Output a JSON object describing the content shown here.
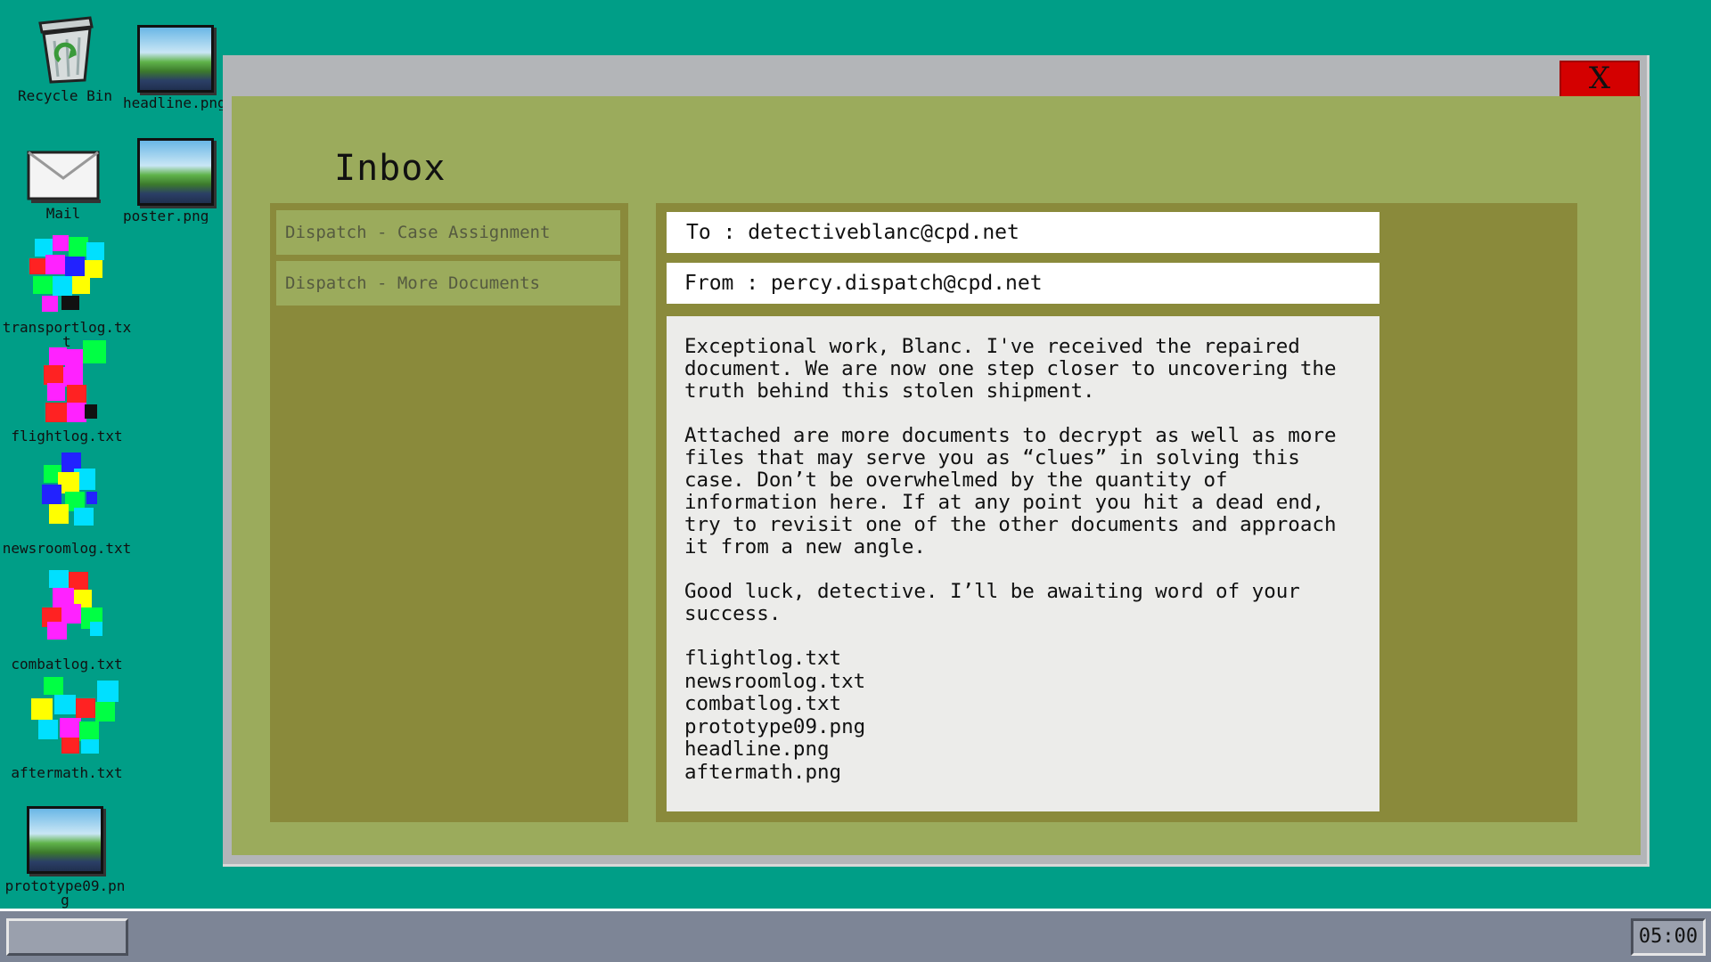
{
  "desktop": {
    "icons": [
      {
        "label": "Recycle Bin",
        "icon": "recycle-bin-icon"
      },
      {
        "label": "headline.png",
        "icon": "image-file-icon"
      },
      {
        "label": "Mail",
        "icon": "mail-envelope-icon"
      },
      {
        "label": "poster.png",
        "icon": "image-file-icon"
      },
      {
        "label": "transportlog.txt",
        "icon": "corrupted-file-icon"
      },
      {
        "label": "flightlog.txt",
        "icon": "corrupted-file-icon"
      },
      {
        "label": "newsroomlog.txt",
        "icon": "corrupted-file-icon"
      },
      {
        "label": "combatlog.txt",
        "icon": "corrupted-file-icon"
      },
      {
        "label": "aftermath.txt",
        "icon": "corrupted-file-icon"
      },
      {
        "label": "prototype09.png",
        "icon": "image-file-icon"
      }
    ]
  },
  "window": {
    "close_label": "X",
    "title": "Inbox",
    "messages": [
      {
        "subject": "Dispatch - Case Assignment"
      },
      {
        "subject": "Dispatch - More Documents"
      }
    ],
    "reader": {
      "to": "To : detectiveblanc@cpd.net",
      "from": "From : percy.dispatch@cpd.net",
      "paragraphs": [
        "Exceptional work, Blanc. I've received the repaired document. We are now one step closer to uncovering the truth behind this stolen shipment.",
        "Attached are more documents to decrypt as well as more files that may serve you as “clues” in solving this case. Don’t be overwhelmed by the quantity of information here. If at any point you hit a dead end, try to revisit one of the other documents and approach it from a new angle.",
        "Good luck, detective. I’ll be awaiting word of your success."
      ],
      "attachments": [
        "flightlog.txt",
        "newsroomlog.txt",
        "combatlog.txt",
        "prototype09.png",
        "headline.png",
        "aftermath.png"
      ]
    }
  },
  "taskbar": {
    "clock": "05:00"
  },
  "colors": {
    "desktop": "#009e87",
    "window_frame": "#b3b5b8",
    "window_body": "#9bab5c",
    "panel": "#8a8a3b",
    "close": "#d40000",
    "taskbar": "#7d8596"
  }
}
